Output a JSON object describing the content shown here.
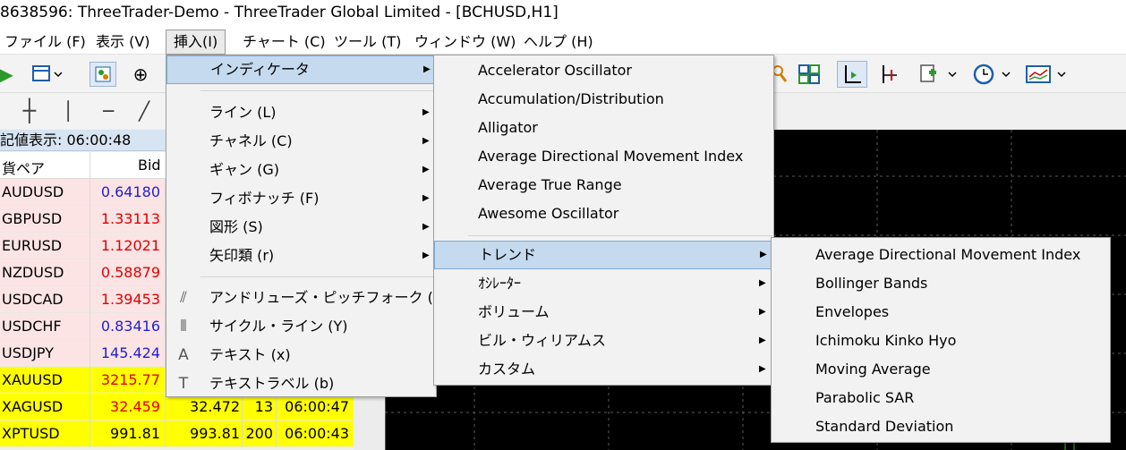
{
  "window": {
    "title": "8638596: ThreeTrader-Demo - ThreeTrader Global Limited - [BCHUSD,H1]"
  },
  "menubar": {
    "items": [
      "ファイル (F)",
      "表示 (V)",
      "挿入(I)",
      "チャート (C)",
      "ツール (T)",
      "ウィンドウ (W)",
      "ヘルプ (H)"
    ]
  },
  "toolbar": {
    "icons": [
      "market-watch-icon",
      "new-window-icon",
      "navigator-icon",
      "crosshair-icon",
      "zoom-icon",
      "tile-windows-icon",
      "period-separators-icon",
      "chart-shift-icon",
      "add-indicator-icon",
      "clock-icon",
      "templates-icon"
    ],
    "draw_tools": [
      "crosshair-tool-icon",
      "vertical-line-icon",
      "horizontal-line-icon",
      "trendline-icon"
    ]
  },
  "market_watch": {
    "header": "記値表示: 06:00:48",
    "col_symbol": "貨ペア",
    "col_bid": "Bid",
    "rows": [
      {
        "symbol": "AUDUSD",
        "bid": "0.64180",
        "ask": "",
        "spread": "",
        "time": "",
        "bid_color": "#1f1fd0",
        "bg": "#fde4e4"
      },
      {
        "symbol": "GBPUSD",
        "bid": "1.33113",
        "ask": "",
        "spread": "",
        "time": "",
        "bid_color": "#e00000",
        "bg": "#fde4e4"
      },
      {
        "symbol": "EURUSD",
        "bid": "1.12021",
        "ask": "",
        "spread": "",
        "time": "",
        "bid_color": "#e00000",
        "bg": "#fde4e4"
      },
      {
        "symbol": "NZDUSD",
        "bid": "0.58879",
        "ask": "",
        "spread": "",
        "time": "",
        "bid_color": "#e00000",
        "bg": "#fde4e4"
      },
      {
        "symbol": "USDCAD",
        "bid": "1.39453",
        "ask": "",
        "spread": "",
        "time": "",
        "bid_color": "#e00000",
        "bg": "#fde4e4"
      },
      {
        "symbol": "USDCHF",
        "bid": "0.83416",
        "ask": "",
        "spread": "",
        "time": "",
        "bid_color": "#1f1fd0",
        "bg": "#fde4e4"
      },
      {
        "symbol": "USDJPY",
        "bid": "145.424",
        "ask": "",
        "spread": "",
        "time": "",
        "bid_color": "#1f1fd0",
        "bg": "#fde4e4"
      },
      {
        "symbol": "XAUUSD",
        "bid": "3215.77",
        "ask": "",
        "spread": "",
        "time": "",
        "bid_color": "#e00000",
        "bg": "#ffff00"
      },
      {
        "symbol": "XAGUSD",
        "bid": "32.459",
        "ask": "32.472",
        "spread": "13",
        "time": "06:00:47",
        "bid_color": "#e00000",
        "bg": "#ffff00"
      },
      {
        "symbol": "XPTUSD",
        "bid": "991.81",
        "ask": "993.81",
        "spread": "200",
        "time": "06:00:43",
        "bid_color": "#000000",
        "bg": "#ffff00"
      }
    ]
  },
  "insert_menu": {
    "items": [
      {
        "label": "インディケータ",
        "submenu": true,
        "highlighted": true,
        "icon": ""
      },
      {
        "label": "ライン (L)",
        "submenu": true,
        "icon": ""
      },
      {
        "label": "チャネル (C)",
        "submenu": true,
        "icon": ""
      },
      {
        "label": "ギャン (G)",
        "submenu": true,
        "icon": ""
      },
      {
        "label": "フィボナッチ (F)",
        "submenu": true,
        "icon": ""
      },
      {
        "label": "図形 (S)",
        "submenu": true,
        "icon": ""
      },
      {
        "label": "矢印類 (r)",
        "submenu": true,
        "icon": ""
      },
      {
        "label": "アンドリューズ・ピッチフォーク (A)",
        "submenu": false,
        "icon": "pitchfork-icon"
      },
      {
        "label": "サイクル・ライン (Y)",
        "submenu": false,
        "icon": "cycle-lines-icon"
      },
      {
        "label": "テキスト (x)",
        "submenu": false,
        "icon": "text-icon"
      },
      {
        "label": "テキストラベル (b)",
        "submenu": false,
        "icon": "text-label-icon"
      }
    ]
  },
  "indicators_menu": {
    "items": [
      {
        "label": "Accelerator Oscillator",
        "submenu": false
      },
      {
        "label": "Accumulation/Distribution",
        "submenu": false
      },
      {
        "label": "Alligator",
        "submenu": false
      },
      {
        "label": "Average Directional Movement Index",
        "submenu": false
      },
      {
        "label": "Average True Range",
        "submenu": false
      },
      {
        "label": "Awesome Oscillator",
        "submenu": false
      },
      {
        "label": "トレンド",
        "submenu": true,
        "highlighted": true
      },
      {
        "label": "ｵｼﾚｰﾀｰ",
        "submenu": true
      },
      {
        "label": "ボリューム",
        "submenu": true
      },
      {
        "label": "ビル・ウィリアムス",
        "submenu": true
      },
      {
        "label": "カスタム",
        "submenu": true
      }
    ]
  },
  "trend_menu": {
    "items": [
      "Average Directional Movement Index",
      "Bollinger Bands",
      "Envelopes",
      "Ichimoku Kinko Hyo",
      "Moving Average",
      "Parabolic SAR",
      "Standard Deviation"
    ]
  },
  "colors": {
    "menu_highlight": "#c5daee",
    "chart_bg": "#000000",
    "chart_grid": "#5a5a5a"
  }
}
